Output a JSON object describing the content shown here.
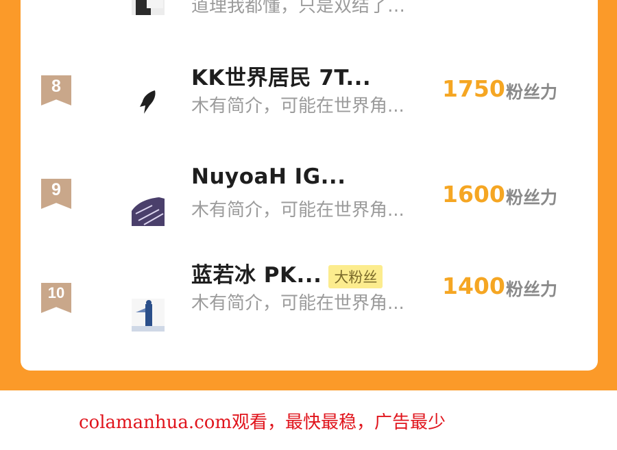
{
  "ranking": {
    "prev_row_desc_fragment": "道理我都懂，只是双结了…",
    "rows": [
      {
        "rank": "8",
        "name": "KK世界居民  7T...",
        "badge": "",
        "desc": "木有简介，可能在世界角...",
        "score": "1750",
        "unit": "粉丝力"
      },
      {
        "rank": "9",
        "name": "NuyoaH  IG...",
        "badge": "",
        "desc": "木有简介，可能在世界角...",
        "score": "1600",
        "unit": "粉丝力"
      },
      {
        "rank": "10",
        "name": "蓝若冰  PK...",
        "badge": "大粉丝",
        "desc": "木有简介，可能在世界角...",
        "score": "1400",
        "unit": "粉丝力"
      }
    ]
  },
  "footer": {
    "watermark": "colamanhua.com观看，最快最稳，广告最少"
  },
  "colors": {
    "frame": "#fb9a29",
    "score": "#f5a623",
    "rank_badge": "#c9a78a",
    "watermark": "#e0141c"
  }
}
